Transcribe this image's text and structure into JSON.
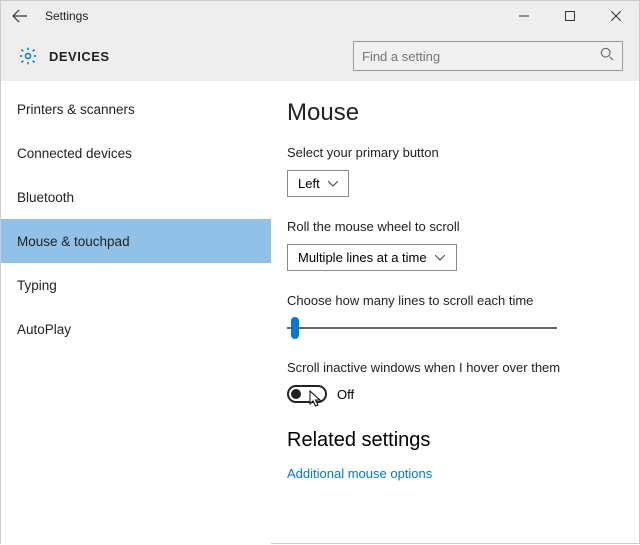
{
  "titlebar": {
    "title": "Settings"
  },
  "header": {
    "section": "DEVICES",
    "search_placeholder": "Find a setting"
  },
  "sidebar": {
    "items": [
      {
        "label": "Printers & scanners",
        "active": false
      },
      {
        "label": "Connected devices",
        "active": false
      },
      {
        "label": "Bluetooth",
        "active": false
      },
      {
        "label": "Mouse & touchpad",
        "active": true
      },
      {
        "label": "Typing",
        "active": false
      },
      {
        "label": "AutoPlay",
        "active": false
      }
    ]
  },
  "content": {
    "page_title": "Mouse",
    "primary_button": {
      "label": "Select your primary button",
      "value": "Left"
    },
    "wheel_scroll": {
      "label": "Roll the mouse wheel to scroll",
      "value": "Multiple lines at a time"
    },
    "lines_slider": {
      "label": "Choose how many lines to scroll each time"
    },
    "inactive_scroll": {
      "label": "Scroll inactive windows when I hover over them",
      "state": "Off"
    },
    "related_heading": "Related settings",
    "related_link": "Additional mouse options"
  }
}
